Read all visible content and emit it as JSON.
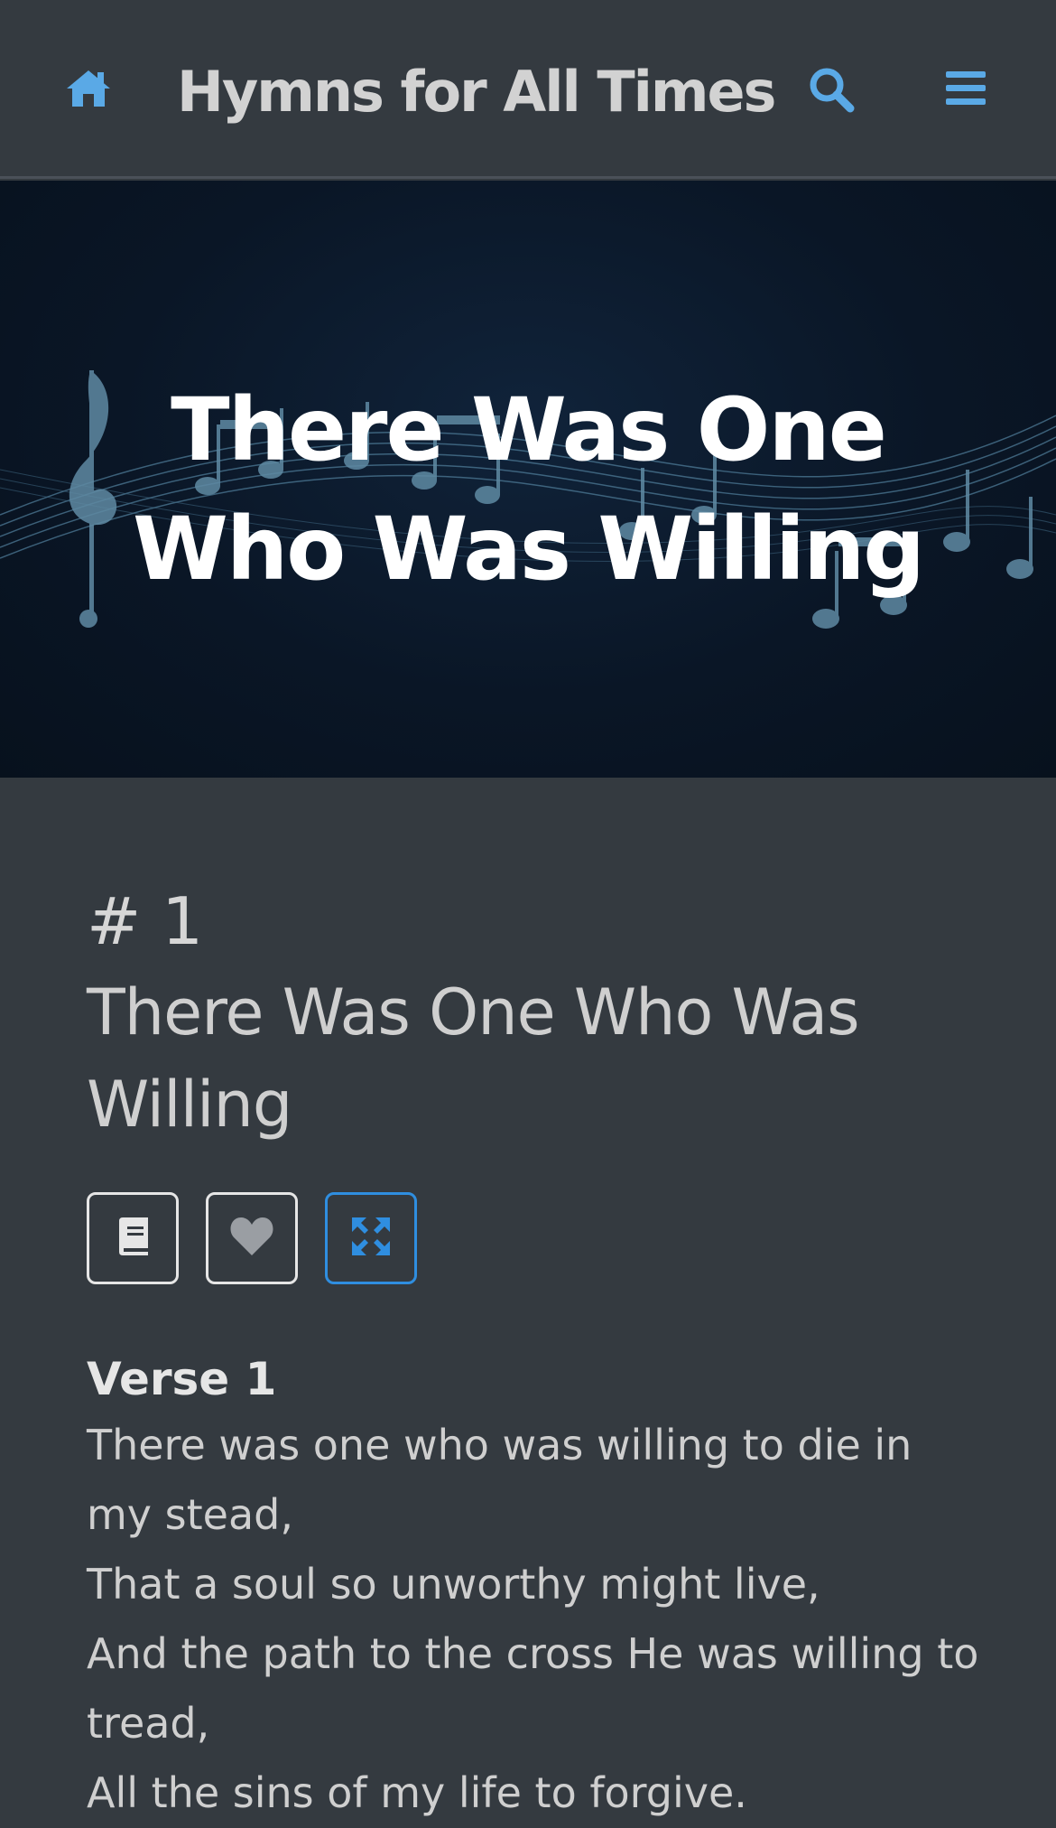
{
  "header": {
    "brand": "Hymns for All Times",
    "home_icon": "home-icon",
    "search_icon": "search-icon",
    "menu_icon": "hamburger-menu-icon"
  },
  "hero": {
    "title": "There Was One Who Was Willing"
  },
  "hymn": {
    "number": "# 1",
    "title": "There Was One Who Was Willing"
  },
  "actions": [
    {
      "icon": "book-icon",
      "active": false
    },
    {
      "icon": "heart-icon",
      "active": false
    },
    {
      "icon": "expand-icon",
      "active": true
    }
  ],
  "verse": {
    "label": "Verse 1",
    "lines": [
      "There was one who was willing to die in my stead,",
      "That a soul so unworthy might live,",
      "And the path to the cross He was willing to tread,",
      "All the sins of my life to forgive."
    ]
  },
  "colors": {
    "accent": "#5aa9e6",
    "active_border": "#2f8ee0",
    "background": "#343a40",
    "hero_bg": "#0a1626"
  }
}
